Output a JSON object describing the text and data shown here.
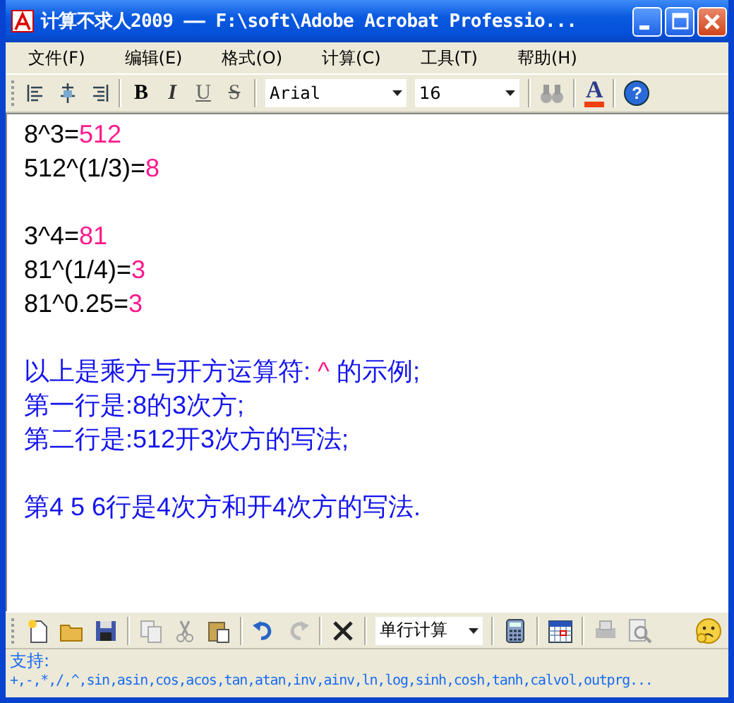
{
  "window": {
    "title": "计算不求人2009 —— F:\\soft\\Adobe Acrobat Professio..."
  },
  "menu": [
    "文件(F)",
    "编辑(E)",
    "格式(O)",
    "计算(C)",
    "工具(T)",
    "帮助(H)"
  ],
  "format_toolbar": {
    "style_buttons": [
      {
        "label": "B",
        "kind": "bold"
      },
      {
        "label": "I",
        "kind": "italic"
      },
      {
        "label": "U",
        "kind": "underline"
      },
      {
        "label": "S",
        "kind": "strike"
      }
    ],
    "font": "Arial",
    "size": "16",
    "color_button": "A",
    "help_button": "?"
  },
  "editor": {
    "lines": [
      {
        "kind": "text",
        "parts": [
          {
            "text": "8^3=",
            "kind": "input"
          },
          {
            "text": "512",
            "kind": "result"
          }
        ]
      },
      {
        "kind": "text",
        "parts": [
          {
            "text": "512^(1/3)=",
            "kind": "input"
          },
          {
            "text": "8",
            "kind": "result"
          }
        ]
      },
      {
        "kind": "blank"
      },
      {
        "kind": "text",
        "parts": [
          {
            "text": "3^4=",
            "kind": "input"
          },
          {
            "text": "81",
            "kind": "result"
          }
        ]
      },
      {
        "kind": "text",
        "parts": [
          {
            "text": "81^(1/4)=",
            "kind": "input"
          },
          {
            "text": "3",
            "kind": "result"
          }
        ]
      },
      {
        "kind": "text",
        "parts": [
          {
            "text": "81^0.25=",
            "kind": "input"
          },
          {
            "text": "3",
            "kind": "result"
          }
        ]
      },
      {
        "kind": "blank"
      },
      {
        "kind": "text",
        "parts": [
          {
            "text": "以上是乘方与开方运算符: ",
            "kind": "note"
          },
          {
            "text": "^",
            "kind": "result"
          },
          {
            "text": " 的示例;",
            "kind": "note"
          }
        ]
      },
      {
        "kind": "text",
        "parts": [
          {
            "text": "第一行是:8的3次方;",
            "kind": "note"
          }
        ]
      },
      {
        "kind": "text",
        "parts": [
          {
            "text": "第二行是:512开3次方的写法;",
            "kind": "note"
          }
        ]
      },
      {
        "kind": "blank"
      },
      {
        "kind": "text",
        "parts": [
          {
            "text": "第4 5 6行是4次方和开4次方的写法.",
            "kind": "note"
          }
        ]
      }
    ]
  },
  "bottom_toolbar": {
    "mode": "单行计算"
  },
  "status": {
    "label": "支持:",
    "functions": "+,-,*,/,^,sin,asin,cos,acos,tan,atan,inv,ainv,ln,log,sinh,cosh,tanh,calvol,outprg..."
  }
}
